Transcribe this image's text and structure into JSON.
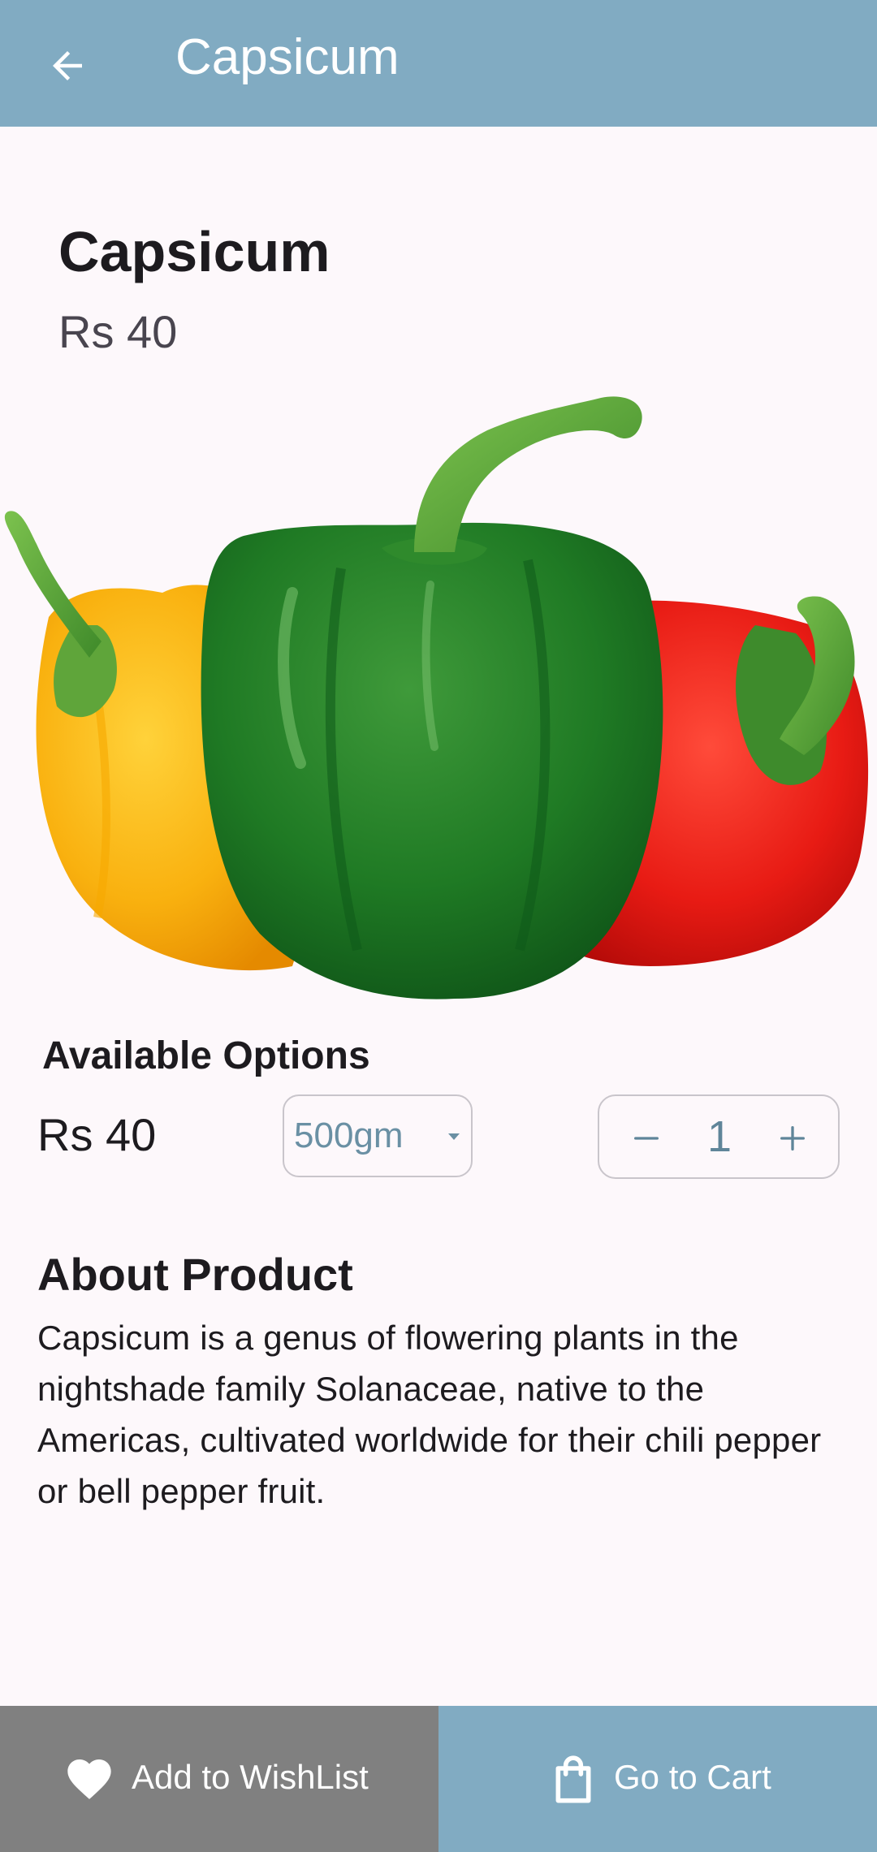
{
  "appbar": {
    "title": "Capsicum",
    "back_icon": "arrow-back-icon",
    "color": "#81abc2"
  },
  "product": {
    "name": "Capsicum",
    "price": "Rs 40",
    "image": "bell-peppers-image"
  },
  "options": {
    "heading": "Available Options",
    "price": "Rs 40",
    "selected_variant": "500gm",
    "quantity": "1"
  },
  "about": {
    "heading": "About Product",
    "text": "Capsicum is a genus of flowering plants in the nightshade family Solanaceae, native to the Americas, cultivated worldwide for their chili pepper or bell pepper fruit."
  },
  "bottom_bar": {
    "wishlist_label": "Add to WishList",
    "wishlist_icon": "heart-icon",
    "wishlist_color": "#808080",
    "cart_label": "Go to Cart",
    "cart_icon": "shopping-bag-icon",
    "cart_color": "#81abc2"
  }
}
